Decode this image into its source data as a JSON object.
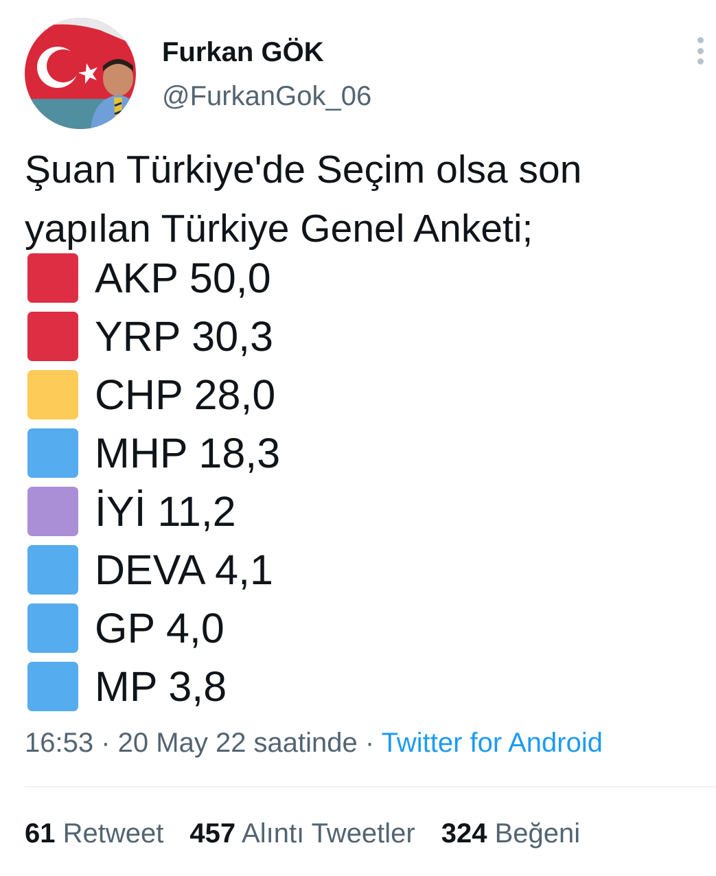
{
  "author": {
    "name": "Furkan GÖK",
    "handle": "@FurkanGok_06",
    "avatar_icon": "profile-photo-turkish-flag"
  },
  "more_icon": "more-vertical-icon",
  "tweet": {
    "text_lines": [
      "Şuan Türkiye'de Seçim olsa son",
      "yapılan Türkiye Genel Anketi;"
    ],
    "poll": [
      {
        "label": "AKP 50,0",
        "color": "#dd2e44"
      },
      {
        "label": "YRP 30,3",
        "color": "#dd2e44"
      },
      {
        "label": "CHP 28,0",
        "color": "#fdcb58"
      },
      {
        "label": "MHP 18,3",
        "color": "#55acee"
      },
      {
        "label": "İYİ 11,2",
        "color": "#aa8ed6"
      },
      {
        "label": "DEVA 4,1",
        "color": "#55acee"
      },
      {
        "label": "GP 4,0",
        "color": "#55acee"
      },
      {
        "label": "MP 3,8",
        "color": "#55acee"
      }
    ]
  },
  "meta": {
    "time": "16:53",
    "separator": " · ",
    "date": "20 May 22 saatinde",
    "source": "Twitter for Android"
  },
  "stats": {
    "retweets": {
      "count": "61",
      "label": "Retweet"
    },
    "quotes": {
      "count": "457",
      "label": "Alıntı Tweetler"
    },
    "likes": {
      "count": "324",
      "label": "Beğeni"
    }
  },
  "colors": {
    "text_primary": "#0f1419",
    "text_secondary": "#536471",
    "link": "#1d9bf0",
    "divider": "#eff3f4"
  }
}
